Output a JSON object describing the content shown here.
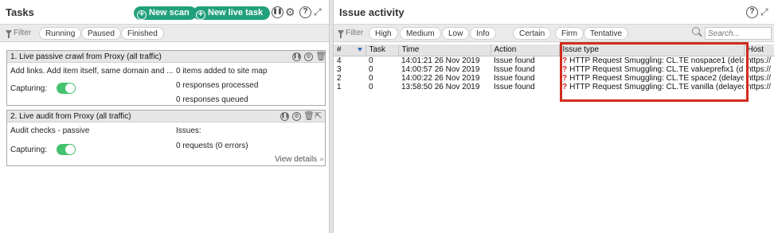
{
  "tasks_panel": {
    "title": "Tasks",
    "new_scan_label": "New scan",
    "new_live_task_label": "New live task",
    "filter_label": "Filter",
    "filters": [
      "Running",
      "Paused",
      "Finished"
    ]
  },
  "task1": {
    "title": "1. Live passive crawl from Proxy (all traffic)",
    "description": "Add links. Add item itself, same domain and ...",
    "stat1": "0 items added to site map",
    "stat2": "0 responses processed",
    "stat3": "0 responses queued",
    "capturing_label": "Capturing:",
    "capturing_on": true
  },
  "task2": {
    "title": "2. Live audit from Proxy (all traffic)",
    "description": "Audit checks - passive",
    "issues_label": "Issues:",
    "requests": "0 requests (0 errors)",
    "capturing_label": "Capturing:",
    "capturing_on": true,
    "view_details": "View details"
  },
  "issues_panel": {
    "title": "Issue activity",
    "filter_label": "Filter",
    "severity_filters": [
      "High",
      "Medium",
      "Low",
      "Info"
    ],
    "confidence_filters": [
      "Certain",
      "Firm",
      "Tentative"
    ],
    "search_placeholder": "Search...",
    "columns": [
      "#",
      "Task",
      "Time",
      "Action",
      "Issue type",
      "Host"
    ],
    "rows": [
      {
        "num": "4",
        "task": "0",
        "time": "14:01:21 26 Nov 2019",
        "action": "Issue found",
        "issue": "HTTP Request Smuggling: CL.TE nospace1 (delay...",
        "host": "https://"
      },
      {
        "num": "3",
        "task": "0",
        "time": "14:00:57 26 Nov 2019",
        "action": "Issue found",
        "issue": "HTTP Request Smuggling: CL.TE valueprefix1 (d...",
        "host": "https://"
      },
      {
        "num": "2",
        "task": "0",
        "time": "14:00:22 26 Nov 2019",
        "action": "Issue found",
        "issue": "HTTP Request Smuggling: CL.TE space2 (delaye...",
        "host": "https://"
      },
      {
        "num": "1",
        "task": "0",
        "time": "13:58:50 26 Nov 2019",
        "action": "Issue found",
        "issue": "HTTP Request Smuggling: CL.TE vanilla (delayed...",
        "host": "https://"
      }
    ]
  },
  "colors": {
    "accent_green": "#22a07c",
    "toggle_on": "#44c26f",
    "highlight_red": "#d12c1f",
    "issue_icon_red": "#dd2222"
  }
}
